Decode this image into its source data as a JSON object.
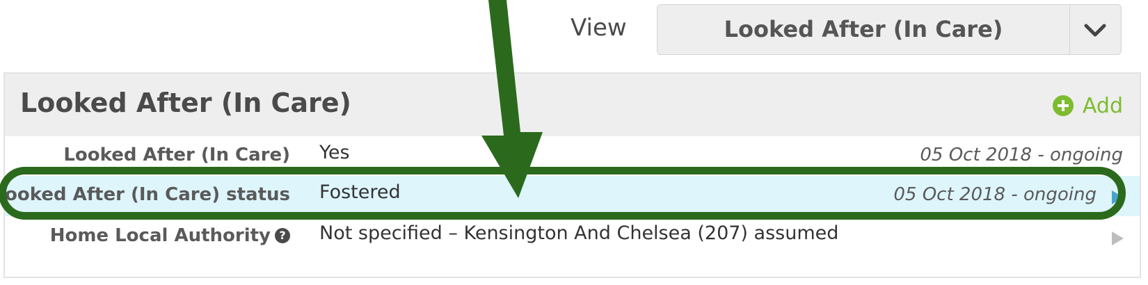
{
  "view": {
    "label": "View",
    "selected": "Looked After (In Care)"
  },
  "panel": {
    "title": "Looked After (In Care)",
    "add_label": "Add",
    "rows": [
      {
        "label": "Looked After (In Care)",
        "value": "Yes",
        "date": "05 Oct 2018 - ongoing"
      },
      {
        "label": "Looked After (In Care) status",
        "value": "Fostered",
        "date": "05 Oct 2018 - ongoing"
      },
      {
        "label": "Home Local Authority",
        "value": "Not specified – Kensington And Chelsea (207) assumed",
        "date": ""
      }
    ]
  },
  "colors": {
    "annotation": "#2b6a1c",
    "highlight_row": "#ddf5fb",
    "add_green": "#7dbb2f",
    "arrow_blue": "#4aa3c8"
  },
  "icons": {
    "dropdown": "chevron-down-icon",
    "add": "plus-circle-icon",
    "row_expand": "triangle-right-icon",
    "help": "question-circle-icon"
  }
}
